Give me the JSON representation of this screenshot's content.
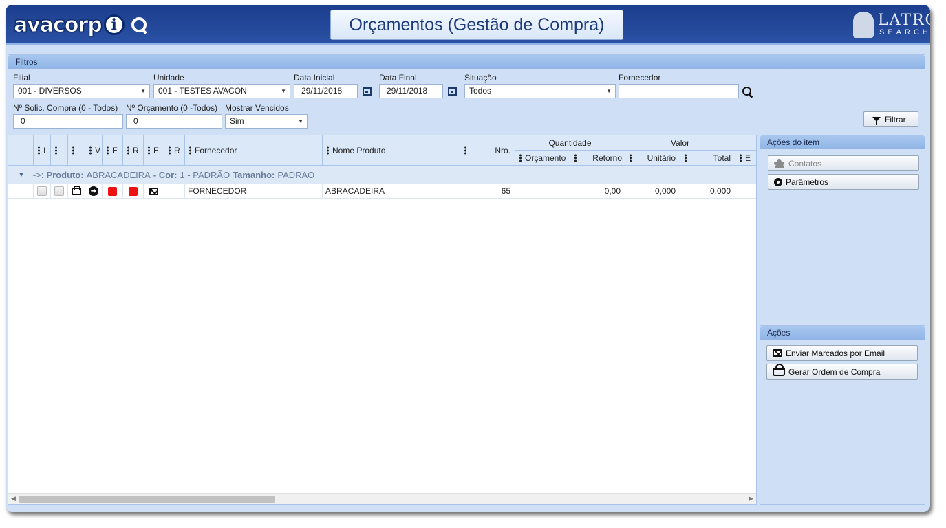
{
  "header": {
    "logo_text": "avacorp",
    "logo_i": "i",
    "title": "Orçamentos (Gestão de Compra)",
    "brand_top": "LATRO",
    "brand_sub": "SEARCH"
  },
  "filters": {
    "panel_title": "Filtros",
    "filial": {
      "label": "Filial",
      "value": "001 - DIVERSOS"
    },
    "unidade": {
      "label": "Unidade",
      "value": "001 - TESTES AVACON"
    },
    "data_inicial": {
      "label": "Data Inicial",
      "value": "29/11/2018"
    },
    "data_final": {
      "label": "Data Final",
      "value": "29/11/2018"
    },
    "situacao": {
      "label": "Situação",
      "value": "Todos"
    },
    "fornecedor": {
      "label": "Fornecedor",
      "value": ""
    },
    "solic_compra": {
      "label": "Nº Solic. Compra (0 - Todos)",
      "value": "0"
    },
    "orcamento": {
      "label": "Nº Orçamento (0 -Todos)",
      "value": "0"
    },
    "mostrar_vencidos": {
      "label": "Mostrar Vencidos",
      "value": "Sim"
    },
    "filtrar_button": "Filtrar"
  },
  "grid": {
    "small_headers": [
      "I",
      "",
      "",
      "V",
      "E",
      "R",
      "E",
      "R"
    ],
    "col_fornecedor": "Fornecedor",
    "col_nome_produto": "Nome Produto",
    "col_nro": "Nro.",
    "group_quantidade": "Quantidade",
    "col_orcamento": "Orçamento",
    "col_retorno": "Retorno",
    "group_valor": "Valor",
    "col_unitario": "Unitário",
    "col_total": "Total",
    "col_extra": "E",
    "group_row": {
      "arrow": "->:",
      "label_produto": "Produto:",
      "produto": "ABRACADEIRA",
      "label_cor": "- Cor:",
      "cor": "1 - PADRÃO",
      "label_tamanho": "Tamanho:",
      "tamanho": "PADRAO"
    },
    "rows": [
      {
        "fornecedor": "FORNECEDOR",
        "nome_produto": "ABRACADEIRA",
        "nro": "65",
        "orcamento": "",
        "retorno": "0,00",
        "unitario": "0,000",
        "total": "0,000"
      }
    ]
  },
  "acoes_item": {
    "title": "Ações do item",
    "contatos": "Contatos",
    "parametros": "Parâmetros"
  },
  "acoes": {
    "title": "Ações",
    "enviar_email": "Enviar Marcados por Email",
    "gerar_ordem": "Gerar Ordem de Compra"
  },
  "colors": {
    "header_bg": "#24489a",
    "panel_bg": "#cfe0f6",
    "status_red": "#ee1111"
  },
  "icons": [
    "search-icon",
    "calendar-icon",
    "filter-icon",
    "printer-icon",
    "arrow-circle-icon",
    "email-icon",
    "people-icon",
    "gear-icon",
    "basket-icon"
  ]
}
